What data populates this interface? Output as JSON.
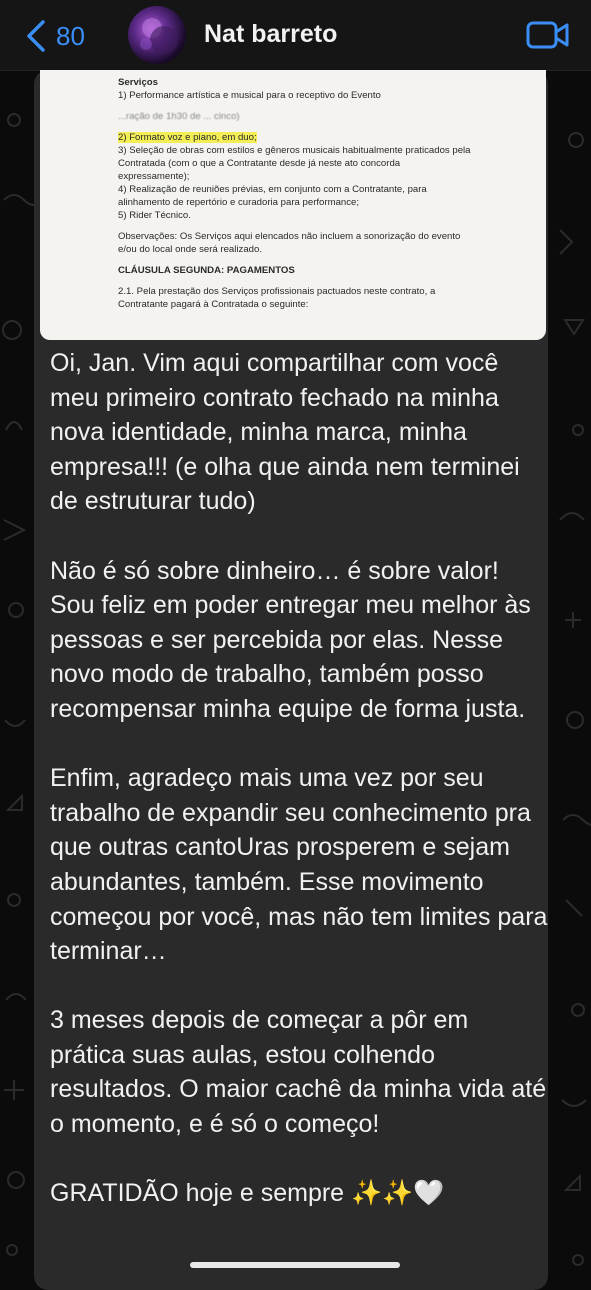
{
  "header": {
    "back_count": "80",
    "contact_name": "Nat barreto"
  },
  "document": {
    "heading": "Serviços",
    "item1": "1) Performance artística e musical para o receptivo do Evento",
    "item1_tail": "...ração de 1h30 de ...                                                         cinco)",
    "item2": "2) Formato voz e piano, em duo;",
    "item3_a": "3) Seleção de obras com estilos e gêneros musicais habitualmente praticados pela",
    "item3_b": "Contratada (com o que a Contratante desde já neste ato concorda",
    "item3_c": "expressamente);",
    "item4_a": "4) Realização de reuniões prévias, em conjunto com a Contratante, para",
    "item4_b": "alinhamento de repertório e curadoria para performance;",
    "item5": "5) Rider Técnico.",
    "obs_a": "Observações: Os Serviços aqui elencados não incluem a sonorização do evento",
    "obs_b": "e/ou do local onde será realizado.",
    "clause": "CLÁUSULA SEGUNDA: PAGAMENTOS",
    "clause_text": "2.1. Pela prestação dos Serviços profissionais pactuados neste contrato, a",
    "clause_text2": "Contratante pagará à Contratada o seguinte:"
  },
  "message": {
    "p1": "Oi, Jan. Vim aqui compartilhar com você meu primeiro contrato fechado na minha nova identidade, minha marca, minha empresa!!! (e olha que ainda nem terminei de estruturar tudo)",
    "p2": "Não é só sobre dinheiro… é sobre valor! Sou feliz em poder entregar meu melhor às pessoas e ser percebida por elas. Nesse novo modo de trabalho, também posso recompensar minha equipe de forma justa.",
    "p3": "Enfim, agradeço mais uma vez por seu trabalho de expandir seu conhecimento pra que outras cantoUras prosperem e sejam abundantes, também. Esse movimento começou por você, mas não tem limites para terminar…",
    "p4": "3 meses depois de começar a  pôr em prática suas aulas, estou colhendo resultados. O maior cachê da minha vida até o momento, e é só o começo!",
    "p5_text": "GRATIDÃO hoje e sempre ",
    "p5_emoji": "✨✨",
    "p5_heart": "🤍"
  },
  "colors": {
    "accent": "#3a8ef6",
    "bubble": "#2a2a2a",
    "highlight": "#f3ee55"
  },
  "icons": [
    "back-chevron-icon",
    "video-call-icon",
    "avatar"
  ]
}
